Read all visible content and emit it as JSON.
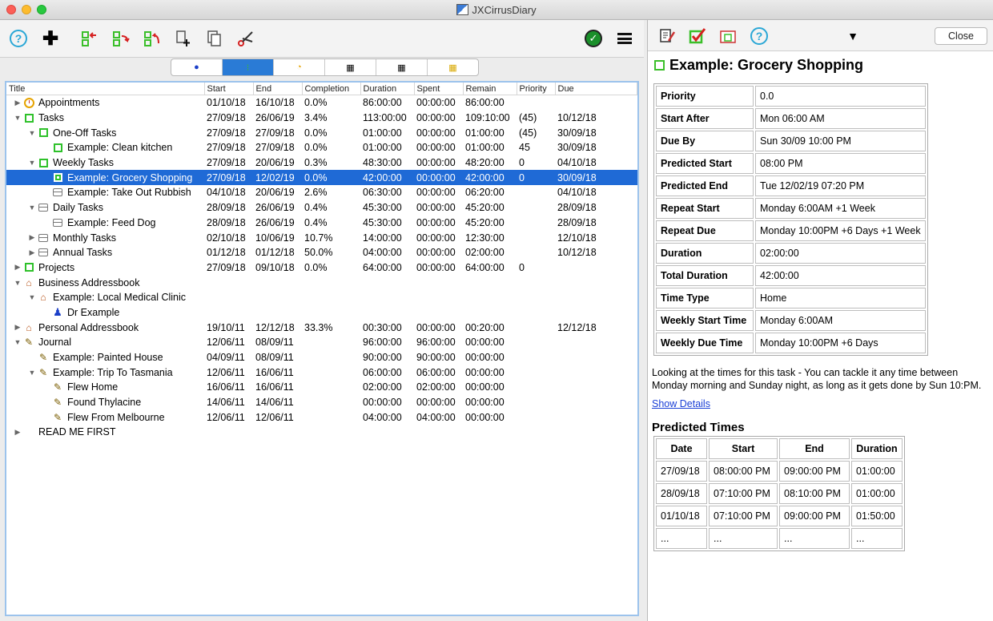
{
  "window": {
    "title": "JXCirrusDiary"
  },
  "tree": {
    "columns": [
      "Title",
      "Start",
      "End",
      "Completion",
      "Duration",
      "Spent",
      "Remain",
      "Priority",
      "Due"
    ],
    "rows": [
      {
        "indent": 0,
        "tri": "▶",
        "icon": "clock",
        "title": "Appointments",
        "start": "01/10/18",
        "end": "16/10/18",
        "completion": "0.0%",
        "duration": "86:00:00",
        "spent": "00:00:00",
        "remain": "86:00:00",
        "priority": "",
        "due": "",
        "sel": false
      },
      {
        "indent": 0,
        "tri": "▼",
        "icon": "task",
        "title": "Tasks",
        "start": "27/09/18",
        "end": "26/06/19",
        "completion": "3.4%",
        "duration": "113:00:00",
        "spent": "00:00:00",
        "remain": "109:10:00",
        "priority": "(45)",
        "due": "10/12/18",
        "sel": false
      },
      {
        "indent": 1,
        "tri": "▼",
        "icon": "task",
        "title": "One-Off Tasks",
        "start": "27/09/18",
        "end": "27/09/18",
        "completion": "0.0%",
        "duration": "01:00:00",
        "spent": "00:00:00",
        "remain": "01:00:00",
        "priority": "(45)",
        "due": "30/09/18",
        "sel": false
      },
      {
        "indent": 2,
        "tri": "",
        "icon": "task",
        "title": "Example: Clean kitchen",
        "start": "27/09/18",
        "end": "27/09/18",
        "completion": "0.0%",
        "duration": "01:00:00",
        "spent": "00:00:00",
        "remain": "01:00:00",
        "priority": "45",
        "due": "30/09/18",
        "sel": false
      },
      {
        "indent": 1,
        "tri": "▼",
        "icon": "task",
        "title": "Weekly Tasks",
        "start": "27/09/18",
        "end": "20/06/19",
        "completion": "0.3%",
        "duration": "48:30:00",
        "spent": "00:00:00",
        "remain": "48:20:00",
        "priority": "0",
        "due": "04/10/18",
        "sel": false
      },
      {
        "indent": 2,
        "tri": "",
        "icon": "task",
        "title": "Example: Grocery Shopping",
        "start": "27/09/18",
        "end": "12/02/19",
        "completion": "0.0%",
        "duration": "42:00:00",
        "spent": "00:00:00",
        "remain": "42:00:00",
        "priority": "0",
        "due": "30/09/18",
        "sel": true
      },
      {
        "indent": 2,
        "tri": "",
        "icon": "repeat",
        "title": "Example: Take Out Rubbish",
        "start": "04/10/18",
        "end": "20/06/19",
        "completion": "2.6%",
        "duration": "06:30:00",
        "spent": "00:00:00",
        "remain": "06:20:00",
        "priority": "",
        "due": "04/10/18",
        "sel": false
      },
      {
        "indent": 1,
        "tri": "▼",
        "icon": "repeat",
        "title": "Daily Tasks",
        "start": "28/09/18",
        "end": "26/06/19",
        "completion": "0.4%",
        "duration": "45:30:00",
        "spent": "00:00:00",
        "remain": "45:20:00",
        "priority": "",
        "due": "28/09/18",
        "sel": false
      },
      {
        "indent": 2,
        "tri": "",
        "icon": "repeat",
        "title": "Example: Feed Dog",
        "start": "28/09/18",
        "end": "26/06/19",
        "completion": "0.4%",
        "duration": "45:30:00",
        "spent": "00:00:00",
        "remain": "45:20:00",
        "priority": "",
        "due": "28/09/18",
        "sel": false
      },
      {
        "indent": 1,
        "tri": "▶",
        "icon": "repeat",
        "title": "Monthly Tasks",
        "start": "02/10/18",
        "end": "10/06/19",
        "completion": "10.7%",
        "duration": "14:00:00",
        "spent": "00:00:00",
        "remain": "12:30:00",
        "priority": "",
        "due": "12/10/18",
        "sel": false
      },
      {
        "indent": 1,
        "tri": "▶",
        "icon": "repeat",
        "title": "Annual Tasks",
        "start": "01/12/18",
        "end": "01/12/18",
        "completion": "50.0%",
        "duration": "04:00:00",
        "spent": "00:00:00",
        "remain": "02:00:00",
        "priority": "",
        "due": "10/12/18",
        "sel": false
      },
      {
        "indent": 0,
        "tri": "▶",
        "icon": "task",
        "title": "Projects",
        "start": "27/09/18",
        "end": "09/10/18",
        "completion": "0.0%",
        "duration": "64:00:00",
        "spent": "00:00:00",
        "remain": "64:00:00",
        "priority": "0",
        "due": "",
        "sel": false
      },
      {
        "indent": 0,
        "tri": "▼",
        "icon": "house",
        "title": "Business Addressbook",
        "start": "",
        "end": "",
        "completion": "",
        "duration": "",
        "spent": "",
        "remain": "",
        "priority": "",
        "due": "",
        "sel": false
      },
      {
        "indent": 1,
        "tri": "▼",
        "icon": "house",
        "title": "Example: Local Medical Clinic",
        "start": "",
        "end": "",
        "completion": "",
        "duration": "",
        "spent": "",
        "remain": "",
        "priority": "",
        "due": "",
        "sel": false
      },
      {
        "indent": 2,
        "tri": "",
        "icon": "person",
        "title": "Dr Example",
        "start": "",
        "end": "",
        "completion": "",
        "duration": "",
        "spent": "",
        "remain": "",
        "priority": "",
        "due": "",
        "sel": false
      },
      {
        "indent": 0,
        "tri": "▶",
        "icon": "house",
        "title": "Personal Addressbook",
        "start": "19/10/11",
        "end": "12/12/18",
        "completion": "33.3%",
        "duration": "00:30:00",
        "spent": "00:00:00",
        "remain": "00:20:00",
        "priority": "",
        "due": "12/12/18",
        "sel": false
      },
      {
        "indent": 0,
        "tri": "▼",
        "icon": "journal",
        "title": "Journal",
        "start": "12/06/11",
        "end": "08/09/11",
        "completion": "",
        "duration": "96:00:00",
        "spent": "96:00:00",
        "remain": "00:00:00",
        "priority": "",
        "due": "",
        "sel": false
      },
      {
        "indent": 1,
        "tri": "",
        "icon": "journal",
        "title": "Example: Painted House",
        "start": "04/09/11",
        "end": "08/09/11",
        "completion": "",
        "duration": "90:00:00",
        "spent": "90:00:00",
        "remain": "00:00:00",
        "priority": "",
        "due": "",
        "sel": false
      },
      {
        "indent": 1,
        "tri": "▼",
        "icon": "journal",
        "title": "Example: Trip To Tasmania",
        "start": "12/06/11",
        "end": "16/06/11",
        "completion": "",
        "duration": "06:00:00",
        "spent": "06:00:00",
        "remain": "00:00:00",
        "priority": "",
        "due": "",
        "sel": false
      },
      {
        "indent": 2,
        "tri": "",
        "icon": "journal",
        "title": "Flew Home",
        "start": "16/06/11",
        "end": "16/06/11",
        "completion": "",
        "duration": "02:00:00",
        "spent": "02:00:00",
        "remain": "00:00:00",
        "priority": "",
        "due": "",
        "sel": false
      },
      {
        "indent": 2,
        "tri": "",
        "icon": "journal",
        "title": "Found Thylacine",
        "start": "14/06/11",
        "end": "14/06/11",
        "completion": "",
        "duration": "00:00:00",
        "spent": "00:00:00",
        "remain": "00:00:00",
        "priority": "",
        "due": "",
        "sel": false
      },
      {
        "indent": 2,
        "tri": "",
        "icon": "journal",
        "title": "Flew From Melbourne",
        "start": "12/06/11",
        "end": "12/06/11",
        "completion": "",
        "duration": "04:00:00",
        "spent": "04:00:00",
        "remain": "00:00:00",
        "priority": "",
        "due": "",
        "sel": false
      },
      {
        "indent": 0,
        "tri": "▶",
        "icon": "none",
        "title": "READ ME FIRST",
        "start": "",
        "end": "",
        "completion": "",
        "duration": "",
        "spent": "",
        "remain": "",
        "priority": "",
        "due": "",
        "sel": false
      }
    ]
  },
  "detail": {
    "close_label": "Close",
    "title": "Example: Grocery Shopping",
    "props": [
      {
        "k": "Priority",
        "v": "0.0"
      },
      {
        "k": "Start After",
        "v": "Mon 06:00 AM"
      },
      {
        "k": "Due By",
        "v": "Sun 30/09 10:00 PM"
      },
      {
        "k": "Predicted Start",
        "v": "08:00 PM"
      },
      {
        "k": "Predicted End",
        "v": "Tue 12/02/19 07:20 PM"
      },
      {
        "k": "Repeat Start",
        "v": "Monday 6:00AM +1 Week"
      },
      {
        "k": "Repeat Due",
        "v": "Monday 10:00PM +6 Days +1 Week"
      },
      {
        "k": "Duration",
        "v": "02:00:00"
      },
      {
        "k": "Total Duration",
        "v": "42:00:00"
      },
      {
        "k": "Time Type",
        "v": "Home"
      },
      {
        "k": "Weekly Start Time",
        "v": "Monday 6:00AM"
      },
      {
        "k": "Weekly Due Time",
        "v": "Monday 10:00PM +6 Days"
      }
    ],
    "description": "Looking at the times for this task - You can tackle it any time between Monday morning and Sunday night, as long as it gets done by Sun 10:PM.",
    "show_details": "Show Details",
    "predicted_title": "Predicted Times",
    "predicted_headers": [
      "Date",
      "Start",
      "End",
      "Duration"
    ],
    "predicted_rows": [
      [
        "27/09/18",
        "08:00:00 PM",
        "09:00:00 PM",
        "01:00:00"
      ],
      [
        "28/09/18",
        "07:10:00 PM",
        "08:10:00 PM",
        "01:00:00"
      ],
      [
        "01/10/18",
        "07:10:00 PM",
        "09:00:00 PM",
        "01:50:00"
      ],
      [
        "...",
        "...",
        "...",
        "..."
      ]
    ]
  }
}
